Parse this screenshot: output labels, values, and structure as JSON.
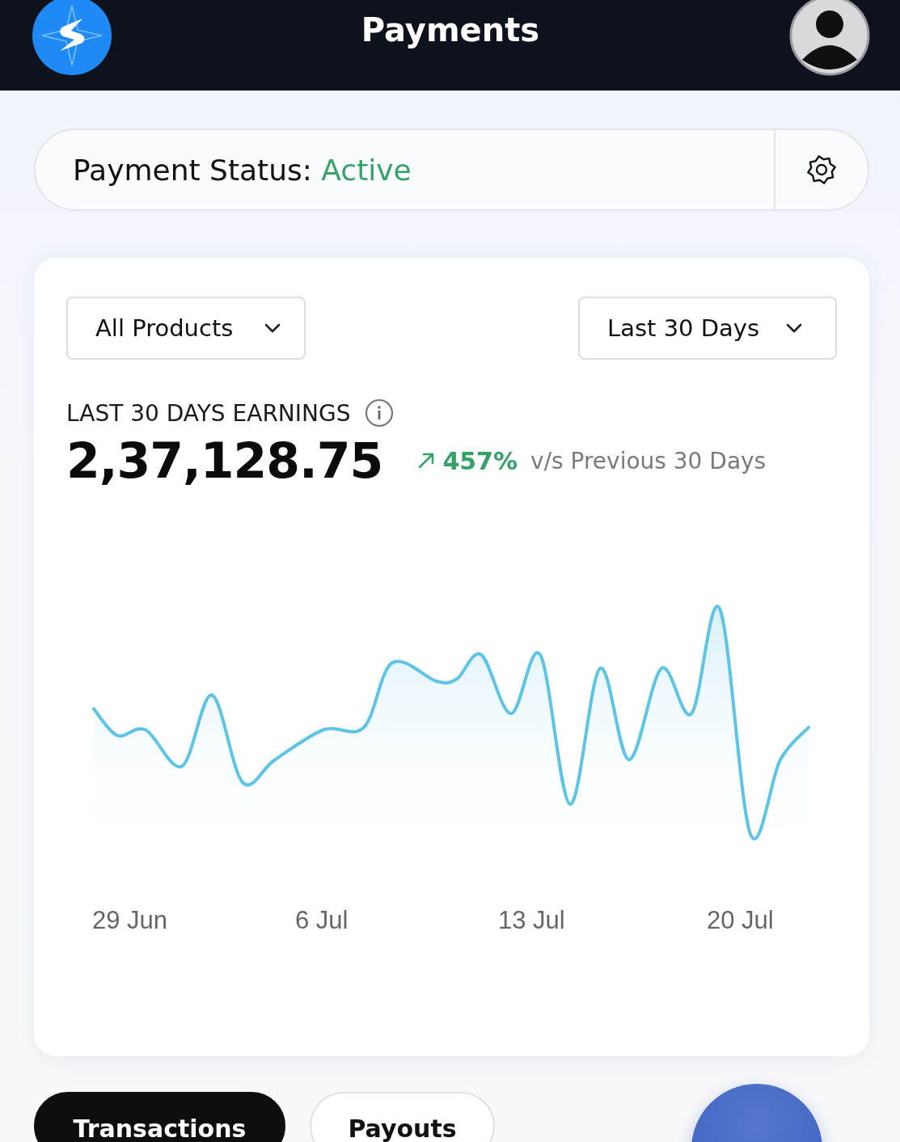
{
  "header": {
    "title": "Payments"
  },
  "status": {
    "label": "Payment Status:",
    "value": "Active"
  },
  "filters": [
    {
      "label": "All Products"
    },
    {
      "label": "Last 30 Days"
    }
  ],
  "earnings": {
    "title": "LAST 30 DAYS EARNINGS",
    "amount": "2,37,128.75",
    "change": "457%",
    "trend_up": true,
    "comparison": "v/s Previous 30 Days"
  },
  "chart": {
    "x_labels": [
      "29 Jun",
      "6 Jul",
      "13 Jul",
      "20 Jul"
    ]
  },
  "tabs": [
    {
      "label": "Transactions",
      "selected": true
    },
    {
      "label": "Payouts",
      "selected": false
    }
  ]
}
